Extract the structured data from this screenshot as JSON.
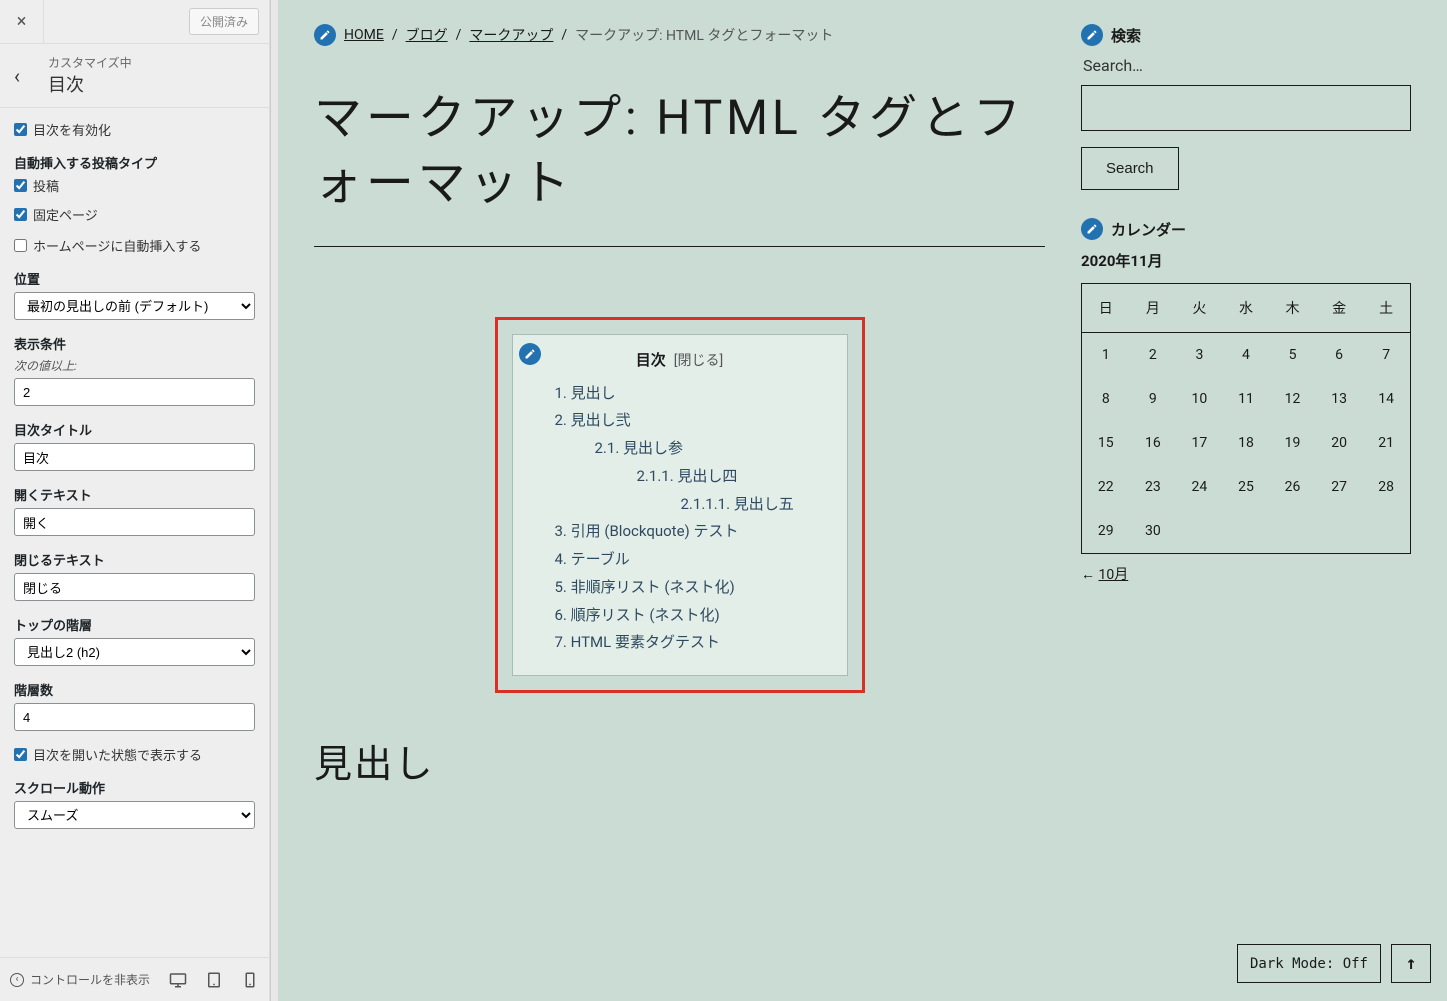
{
  "sidebar": {
    "close_icon": "×",
    "publish_btn": "公開済み",
    "customizing": "カスタマイズ中",
    "section_title": "目次",
    "enable_toc": "目次を有効化",
    "auto_insert_label": "自動挿入する投稿タイプ",
    "post": "投稿",
    "page": "固定ページ",
    "homepage_auto": "ホームページに自動挿入する",
    "position_label": "位置",
    "position_value": "最初の見出しの前 (デフォルト)",
    "display_cond_label": "表示条件",
    "display_cond_sub": "次の値以上:",
    "display_cond_value": "2",
    "toc_title_label": "目次タイトル",
    "toc_title_value": "目次",
    "open_text_label": "開くテキスト",
    "open_text_value": "開く",
    "close_text_label": "閉じるテキスト",
    "close_text_value": "閉じる",
    "top_level_label": "トップの階層",
    "top_level_value": "見出し2 (h2)",
    "depth_label": "階層数",
    "depth_value": "4",
    "initial_open": "目次を開いた状態で表示する",
    "scroll_label": "スクロール動作",
    "scroll_value": "スムーズ",
    "footer_toggle": "コントロールを非表示"
  },
  "breadcrumb": {
    "home": "HOME",
    "blog": "ブログ",
    "markup": "マークアップ",
    "current": "マークアップ: HTML タグとフォーマット"
  },
  "post": {
    "title": "マークアップ: HTML タグとフォーマット",
    "h2_first": "見出し"
  },
  "toc": {
    "title": "目次",
    "toggle": "[閉じる]",
    "items": [
      {
        "num": "1.",
        "text": "見出し",
        "lvl": 1
      },
      {
        "num": "2.",
        "text": "見出し弐",
        "lvl": 1
      },
      {
        "num": "2.1.",
        "text": "見出し参",
        "lvl": 2
      },
      {
        "num": "2.1.1.",
        "text": "見出し四",
        "lvl": 3
      },
      {
        "num": "2.1.1.1.",
        "text": "見出し五",
        "lvl": 4
      },
      {
        "num": "3.",
        "text": "引用 (Blockquote) テスト",
        "lvl": 1
      },
      {
        "num": "4.",
        "text": "テーブル",
        "lvl": 1
      },
      {
        "num": "5.",
        "text": "非順序リスト (ネスト化)",
        "lvl": 1
      },
      {
        "num": "6.",
        "text": "順序リスト (ネスト化)",
        "lvl": 1
      },
      {
        "num": "7.",
        "text": "HTML 要素タグテスト",
        "lvl": 1
      }
    ]
  },
  "widgets": {
    "search_title": "検索",
    "search_label": "Search…",
    "search_btn": "Search",
    "calendar_title": "カレンダー",
    "calendar_month": "2020年11月",
    "calendar_days": [
      "日",
      "月",
      "火",
      "水",
      "木",
      "金",
      "土"
    ],
    "calendar_weeks": [
      [
        "1",
        "2",
        "3",
        "4",
        "5",
        "6",
        "7"
      ],
      [
        "8",
        "9",
        "10",
        "11",
        "12",
        "13",
        "14"
      ],
      [
        "15",
        "16",
        "17",
        "18",
        "19",
        "20",
        "21"
      ],
      [
        "22",
        "23",
        "24",
        "25",
        "26",
        "27",
        "28"
      ],
      [
        "29",
        "30",
        "",
        "",
        "",
        "",
        ""
      ]
    ],
    "calendar_prev": "10月"
  },
  "floaters": {
    "dark_mode": "Dark Mode: Off",
    "top_arrow": "↑"
  }
}
